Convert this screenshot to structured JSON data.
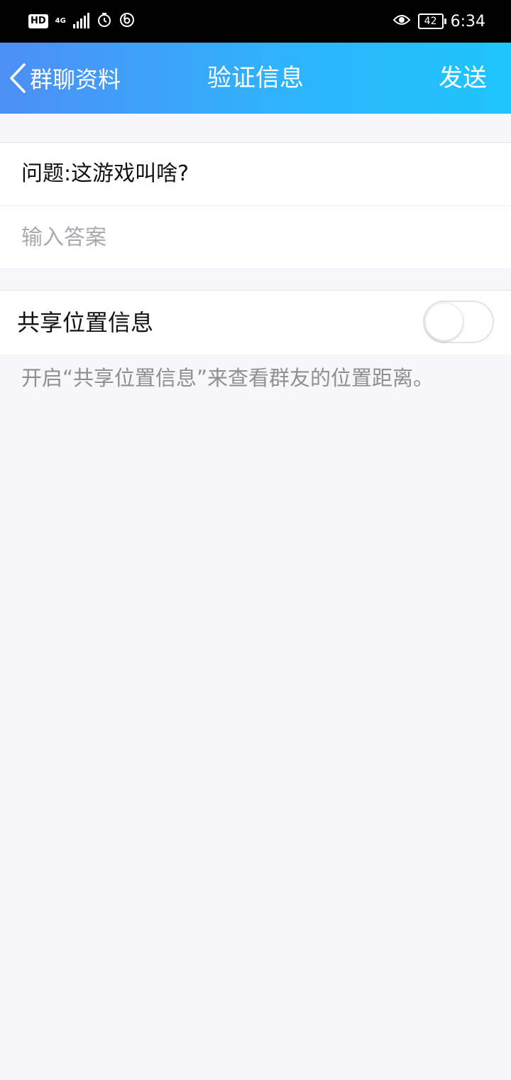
{
  "status_bar": {
    "hd_label": "HD",
    "network_label": "4G",
    "time": "6:34",
    "battery_level": "42"
  },
  "nav": {
    "back_label": "群聊资料",
    "title": "验证信息",
    "send_label": "发送",
    "gradient_start": "#4d8ff5",
    "gradient_end": "#1ec5fd"
  },
  "verification": {
    "question": "问题:这游戏叫啥?",
    "answer_placeholder": "输入答案",
    "answer_value": ""
  },
  "location": {
    "label": "共享位置信息",
    "enabled": false,
    "hint": "开启“共享位置信息”来查看群友的位置距离。"
  }
}
